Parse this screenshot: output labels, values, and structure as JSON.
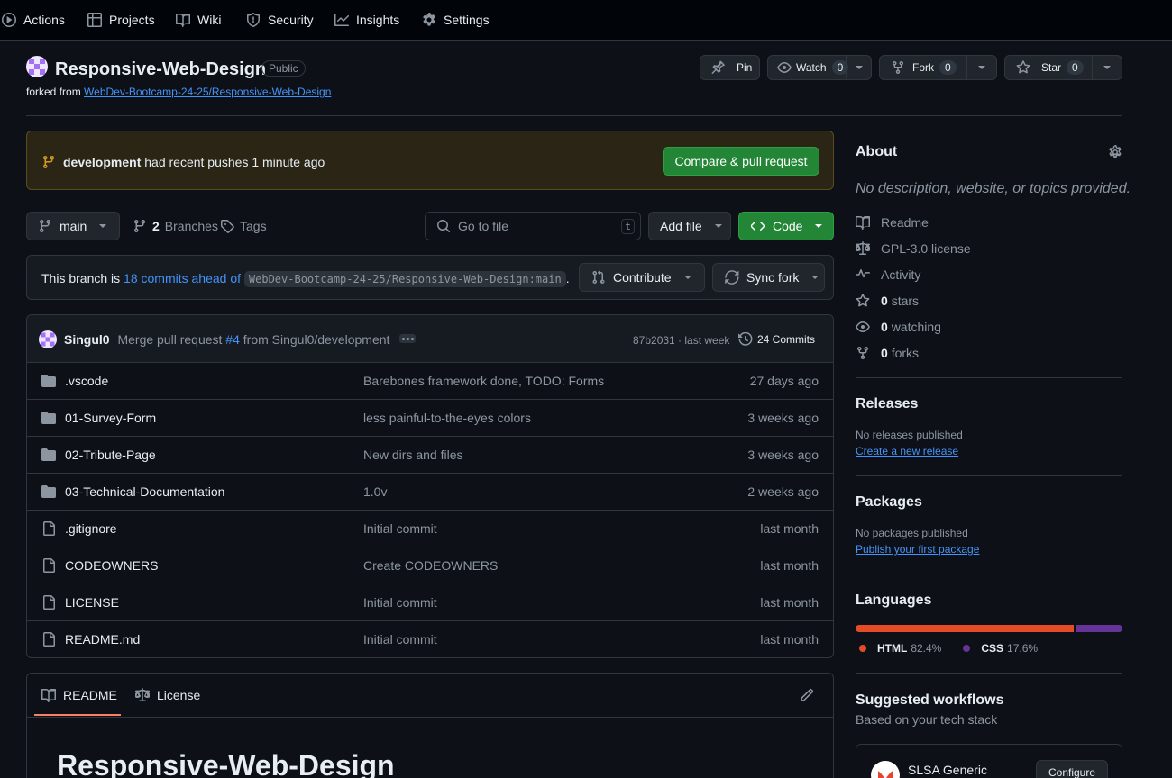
{
  "nav": {
    "items": [
      {
        "label": "Actions",
        "icon": "play-icon"
      },
      {
        "label": "Projects",
        "icon": "table-icon"
      },
      {
        "label": "Wiki",
        "icon": "book-icon"
      },
      {
        "label": "Security",
        "icon": "shield-icon"
      },
      {
        "label": "Insights",
        "icon": "graph-icon"
      },
      {
        "label": "Settings",
        "icon": "gear-icon"
      }
    ]
  },
  "repo": {
    "name": "Responsive-Web-Design",
    "visibility": "Public",
    "forked_prefix": "forked from",
    "forked_from": "WebDev-Bootcamp-24-25/Responsive-Web-Design"
  },
  "actions": {
    "pin": "Pin",
    "watch": "Watch",
    "watch_count": "0",
    "fork": "Fork",
    "fork_count": "0",
    "star": "Star",
    "star_count": "0"
  },
  "banner": {
    "branch": "development",
    "text": "had recent pushes 1 minute ago",
    "button": "Compare & pull request"
  },
  "branchbar": {
    "branch": "main",
    "branches_count": "2",
    "branches_label": "Branches",
    "tags_label": "Tags",
    "search_placeholder": "Go to file",
    "search_key": "t",
    "add_file": "Add file",
    "code": "Code"
  },
  "ahead": {
    "prefix": "This branch is",
    "link": "18 commits ahead of",
    "target": "WebDev-Bootcamp-24-25/Responsive-Web-Design:main",
    "suffix": ".",
    "contribute": "Contribute",
    "sync": "Sync fork"
  },
  "commit": {
    "author": "Singul0",
    "message_prefix": "Merge pull request",
    "pr": "#4",
    "message_suffix": "from Singul0/development",
    "sha_time": "87b2031 · last week",
    "commits": "24 Commits"
  },
  "files": [
    {
      "type": "folder",
      "name": ".vscode",
      "message": "Barebones framework done, TODO: Forms",
      "date": "27 days ago"
    },
    {
      "type": "folder",
      "name": "01-Survey-Form",
      "message": "less painful-to-the-eyes colors",
      "date": "3 weeks ago"
    },
    {
      "type": "folder",
      "name": "02-Tribute-Page",
      "message": "New dirs and files",
      "date": "3 weeks ago"
    },
    {
      "type": "folder",
      "name": "03-Technical-Documentation",
      "message": "1.0v",
      "date": "2 weeks ago"
    },
    {
      "type": "file",
      "name": ".gitignore",
      "message": "Initial commit",
      "date": "last month"
    },
    {
      "type": "file",
      "name": "CODEOWNERS",
      "message": "Create CODEOWNERS",
      "date": "last month"
    },
    {
      "type": "file",
      "name": "LICENSE",
      "message": "Initial commit",
      "date": "last month"
    },
    {
      "type": "file",
      "name": "README.md",
      "message": "Initial commit",
      "date": "last month"
    }
  ],
  "readme": {
    "tab_readme": "README",
    "tab_license": "License",
    "heading": "Responsive-Web-Design"
  },
  "about": {
    "title": "About",
    "description": "No description, website, or topics provided.",
    "readme": "Readme",
    "license": "GPL-3.0 license",
    "activity": "Activity",
    "stars_count": "0",
    "stars_label": "stars",
    "watching_count": "0",
    "watching_label": "watching",
    "forks_count": "0",
    "forks_label": "forks"
  },
  "releases": {
    "title": "Releases",
    "empty": "No releases published",
    "link": "Create a new release"
  },
  "packages": {
    "title": "Packages",
    "empty": "No packages published",
    "link": "Publish your first package"
  },
  "languages": {
    "title": "Languages",
    "items": [
      {
        "name": "HTML",
        "percent": "82.4%",
        "fraction": 0.824,
        "color": "#e34c26"
      },
      {
        "name": "CSS",
        "percent": "17.6%",
        "fraction": 0.176,
        "color": "#663399"
      }
    ]
  },
  "workflows": {
    "title": "Suggested workflows",
    "subtitle": "Based on your tech stack",
    "item_name": "SLSA Generic",
    "configure": "Configure"
  }
}
